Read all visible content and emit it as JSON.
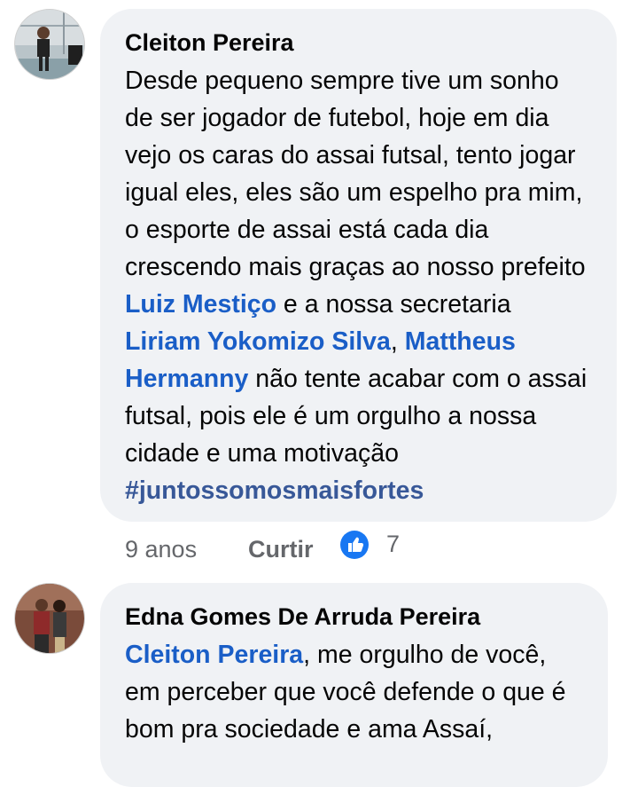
{
  "comments": [
    {
      "author": "Cleiton Pereira",
      "text": {
        "p1": "Desde pequeno sempre tive um sonho de ser jogador de futebol, hoje em dia vejo os caras do assai futsal, tento jogar igual eles, eles são um espelho pra mim, o esporte de assai está cada dia crescendo mais graças ao nosso prefeito ",
        "tag1": "Luiz Mestiço",
        "p2": " e a nossa secretaria ",
        "tag2": "Liriam Yokomizo Silva",
        "p3": ", ",
        "tag3": "Mattheus Hermanny",
        "p4": " não tente acabar com o assai futsal, pois ele é um orgulho a nossa cidade e uma motivação ",
        "hashtag": "#juntossomosmaisfortes"
      },
      "time": "9 anos",
      "like_label": "Curtir",
      "reaction_icon": "thumbs-up-icon",
      "reaction_count": "7"
    },
    {
      "author": "Edna Gomes De Arruda Pereira",
      "text": {
        "tag1": "Cleiton Pereira",
        "p1": ", me orgulho de você, em perceber que você defende o que é bom pra sociedade e ama Assaí,"
      }
    }
  ],
  "colors": {
    "link": "#1a5ec7",
    "hashtag": "#385898",
    "bubble": "#f0f2f5",
    "like": "#1877f2"
  }
}
